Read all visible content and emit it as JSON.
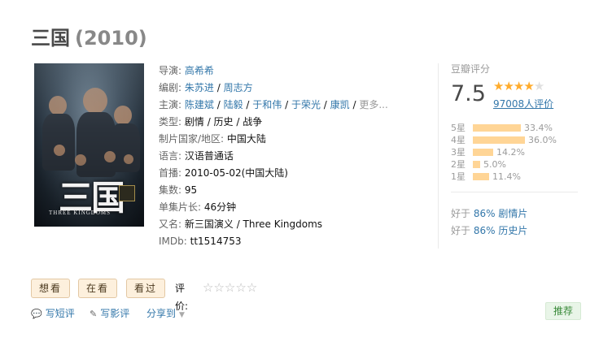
{
  "title": "三国",
  "year": "(2010)",
  "poster": {
    "big_text": "三国",
    "sub_text": "THREE KINGDOMS"
  },
  "info": {
    "director_label": "导演",
    "director": "高希希",
    "writer_label": "编剧",
    "writers": [
      "朱苏进",
      "周志方"
    ],
    "cast_label": "主演",
    "cast": [
      "陈建斌",
      "陆毅",
      "于和伟",
      "于荣光",
      "康凯"
    ],
    "cast_more": "更多...",
    "genre_label": "类型:",
    "genres": "剧情 / 历史 / 战争",
    "country_label": "制片国家/地区:",
    "country": "中国大陆",
    "language_label": "语言:",
    "language": "汉语普通话",
    "premiere_label": "首播:",
    "premiere": "2010-05-02(中国大陆)",
    "episodes_label": "集数:",
    "episodes": "95",
    "runtime_label": "单集片长:",
    "runtime": "46分钟",
    "aka_label": "又名:",
    "aka": "新三国演义 / Three Kingdoms",
    "imdb_label": "IMDb:",
    "imdb": "tt1514753"
  },
  "rating": {
    "label": "豆瓣评分",
    "score": "7.5",
    "stars_filled": 4,
    "stars_total": 5,
    "votes": "97008人评价",
    "distribution": [
      {
        "star": "5星",
        "pct": "33.4%",
        "value": 33.4
      },
      {
        "star": "4星",
        "pct": "36.0%",
        "value": 36.0
      },
      {
        "star": "3星",
        "pct": "14.2%",
        "value": 14.2
      },
      {
        "star": "2星",
        "pct": "5.0%",
        "value": 5.0
      },
      {
        "star": "1星",
        "pct": "11.4%",
        "value": 11.4
      }
    ],
    "better_than": [
      {
        "prefix": "好于",
        "value": "86% 剧情片"
      },
      {
        "prefix": "好于",
        "value": "86% 历史片"
      }
    ]
  },
  "actions": {
    "want": "想看",
    "watching": "在看",
    "watched": "看过",
    "rate_label": "评价:",
    "rate_stars": "☆☆☆☆☆"
  },
  "links": {
    "short_review": "写短评",
    "review": "写影评",
    "share": "分享到"
  },
  "recommend": "推荐",
  "colors": {
    "link": "#3377aa",
    "star": "#ffac2d",
    "bar": "#ffd596",
    "button_bg": "#fdf0dd"
  }
}
